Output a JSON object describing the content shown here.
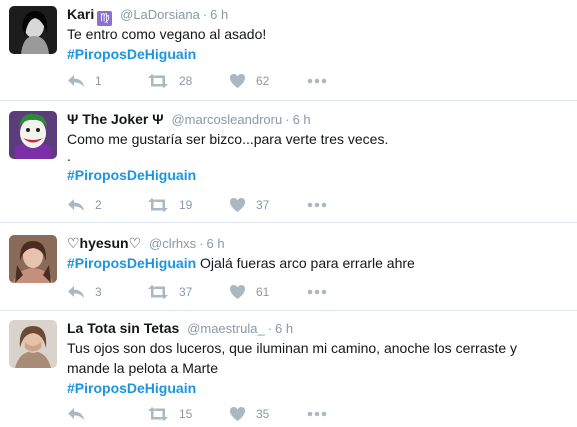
{
  "tweets": [
    {
      "name": "Kari",
      "badge": "♍",
      "handle": "@LaDorsiana",
      "time": "6 h",
      "lines": [
        "Te entro como vegano al asado!"
      ],
      "hashtag_prefix": "#",
      "hashtag": "PiroposDeHiguain",
      "hashtag_suffix": "",
      "replies": "1",
      "retweets": "28",
      "likes": "62"
    },
    {
      "name": "Ψ The Joker Ψ",
      "handle": "@marcosleandroru",
      "time": "6 h",
      "lines": [
        "Como me gustaría ser bizco...para verte tres veces.",
        "."
      ],
      "hashtag_prefix": "#",
      "hashtag": "PiroposDeHiguain",
      "hashtag_suffix": "",
      "replies": "2",
      "retweets": "19",
      "likes": "37"
    },
    {
      "name": "♡hyesun♡",
      "handle": "@clrhxs",
      "time": "6 h",
      "lines": [],
      "hashtag_prefix": "#",
      "hashtag": "PiroposDeHiguain",
      "hashtag_suffix": " Ojalá fueras arco para errarle ahre",
      "replies": "3",
      "retweets": "37",
      "likes": "61"
    },
    {
      "name": "La Tota sin Tetas",
      "handle": "@maestrula_",
      "time": "6 h",
      "lines": [
        "Tus ojos son dos luceros, que iluminan mi camino, anoche los cerraste y",
        "mande la pelota a Marte"
      ],
      "hashtag_prefix": "#",
      "hashtag": "PiroposDeHiguain",
      "hashtag_suffix": "",
      "replies": "",
      "retweets": "15",
      "likes": "35"
    }
  ],
  "icons": {
    "reply": "reply-icon",
    "retweet": "retweet-icon",
    "like": "heart-icon",
    "more": "more-dots-icon"
  },
  "colors": {
    "hashtag": "#1b95e0",
    "muted": "#8899a6",
    "icon": "#aab8c2",
    "divider": "#e1e8ed",
    "zodiac_badge": "#8f6dce"
  }
}
